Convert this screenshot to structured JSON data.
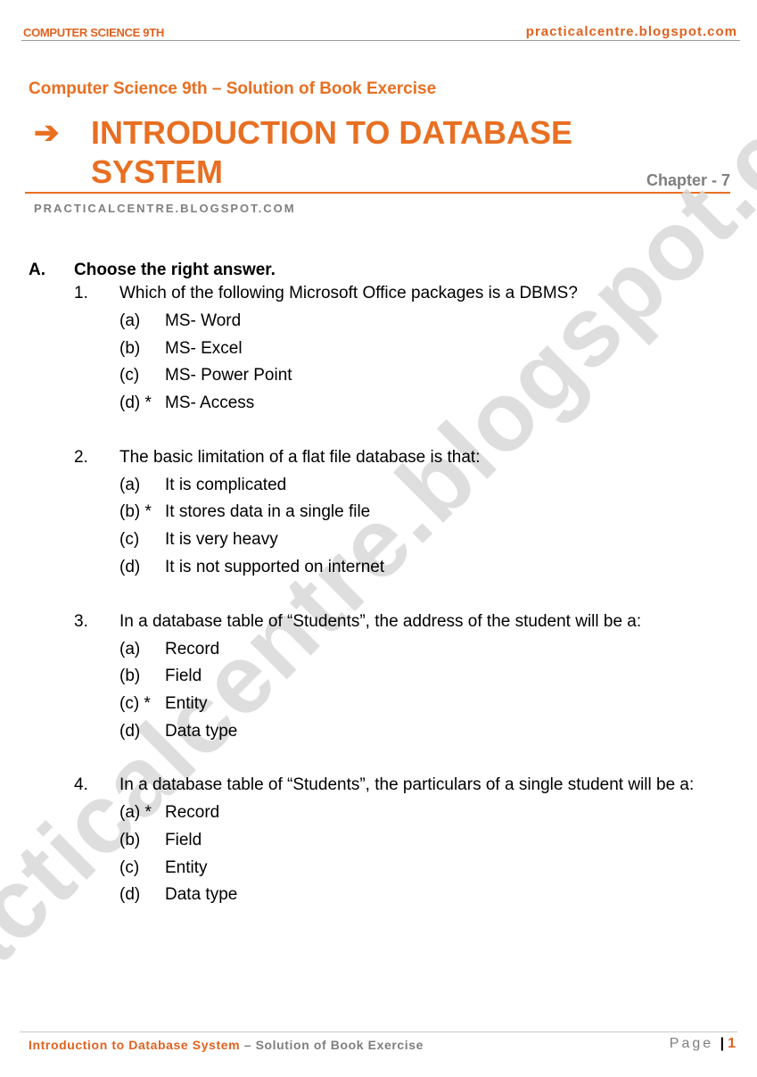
{
  "header": {
    "left": "COMPUTER SCIENCE 9TH",
    "right": "practicalcentre.blogspot.com"
  },
  "title_block": {
    "subtitle": "Computer Science 9th – Solution of Book Exercise",
    "arrow_icon": "➔",
    "title": "INTRODUCTION TO DATABASE SYSTEM",
    "chapter": "Chapter - 7",
    "site_caps": "PRACTICALCENTRE.BLOGSPOT.COM"
  },
  "watermark": "practicalcentre.blogspot.com",
  "section": {
    "letter": "A.",
    "title": "Choose the right answer.",
    "questions": [
      {
        "number": "1.",
        "text": "Which of the following Microsoft Office packages is a DBMS?",
        "options": [
          {
            "label": "(a)",
            "text": "MS- Word"
          },
          {
            "label": "(b)",
            "text": "MS- Excel"
          },
          {
            "label": "(c)",
            "text": "MS- Power Point"
          },
          {
            "label": "(d) *",
            "text": "MS- Access"
          }
        ]
      },
      {
        "number": "2.",
        "text": "The basic limitation of a flat file database is that:",
        "options": [
          {
            "label": "(a)",
            "text": "It is complicated"
          },
          {
            "label": "(b) *",
            "text": "It stores data in a single file"
          },
          {
            "label": "(c)",
            "text": "It is very heavy"
          },
          {
            "label": "(d)",
            "text": "It is not supported on internet"
          }
        ]
      },
      {
        "number": "3.",
        "text": "In a database table of “Students”, the address of the student will be a:",
        "options": [
          {
            "label": "(a)",
            "text": "Record"
          },
          {
            "label": "(b)",
            "text": "Field"
          },
          {
            "label": "(c) *",
            "text": "Entity"
          },
          {
            "label": "(d)",
            "text": "Data type"
          }
        ]
      },
      {
        "number": "4.",
        "text": "In a database table of “Students”, the particulars of a single student will be a:",
        "options": [
          {
            "label": "(a) *",
            "text": "Record"
          },
          {
            "label": "(b)",
            "text": "Field"
          },
          {
            "label": "(c)",
            "text": "Entity"
          },
          {
            "label": "(d)",
            "text": "Data type"
          }
        ]
      }
    ]
  },
  "footer": {
    "left_title": "Introduction to Database System",
    "left_rest": " – Solution of Book Exercise",
    "page_word": "Page",
    "separator": "|",
    "page_number": "1"
  }
}
